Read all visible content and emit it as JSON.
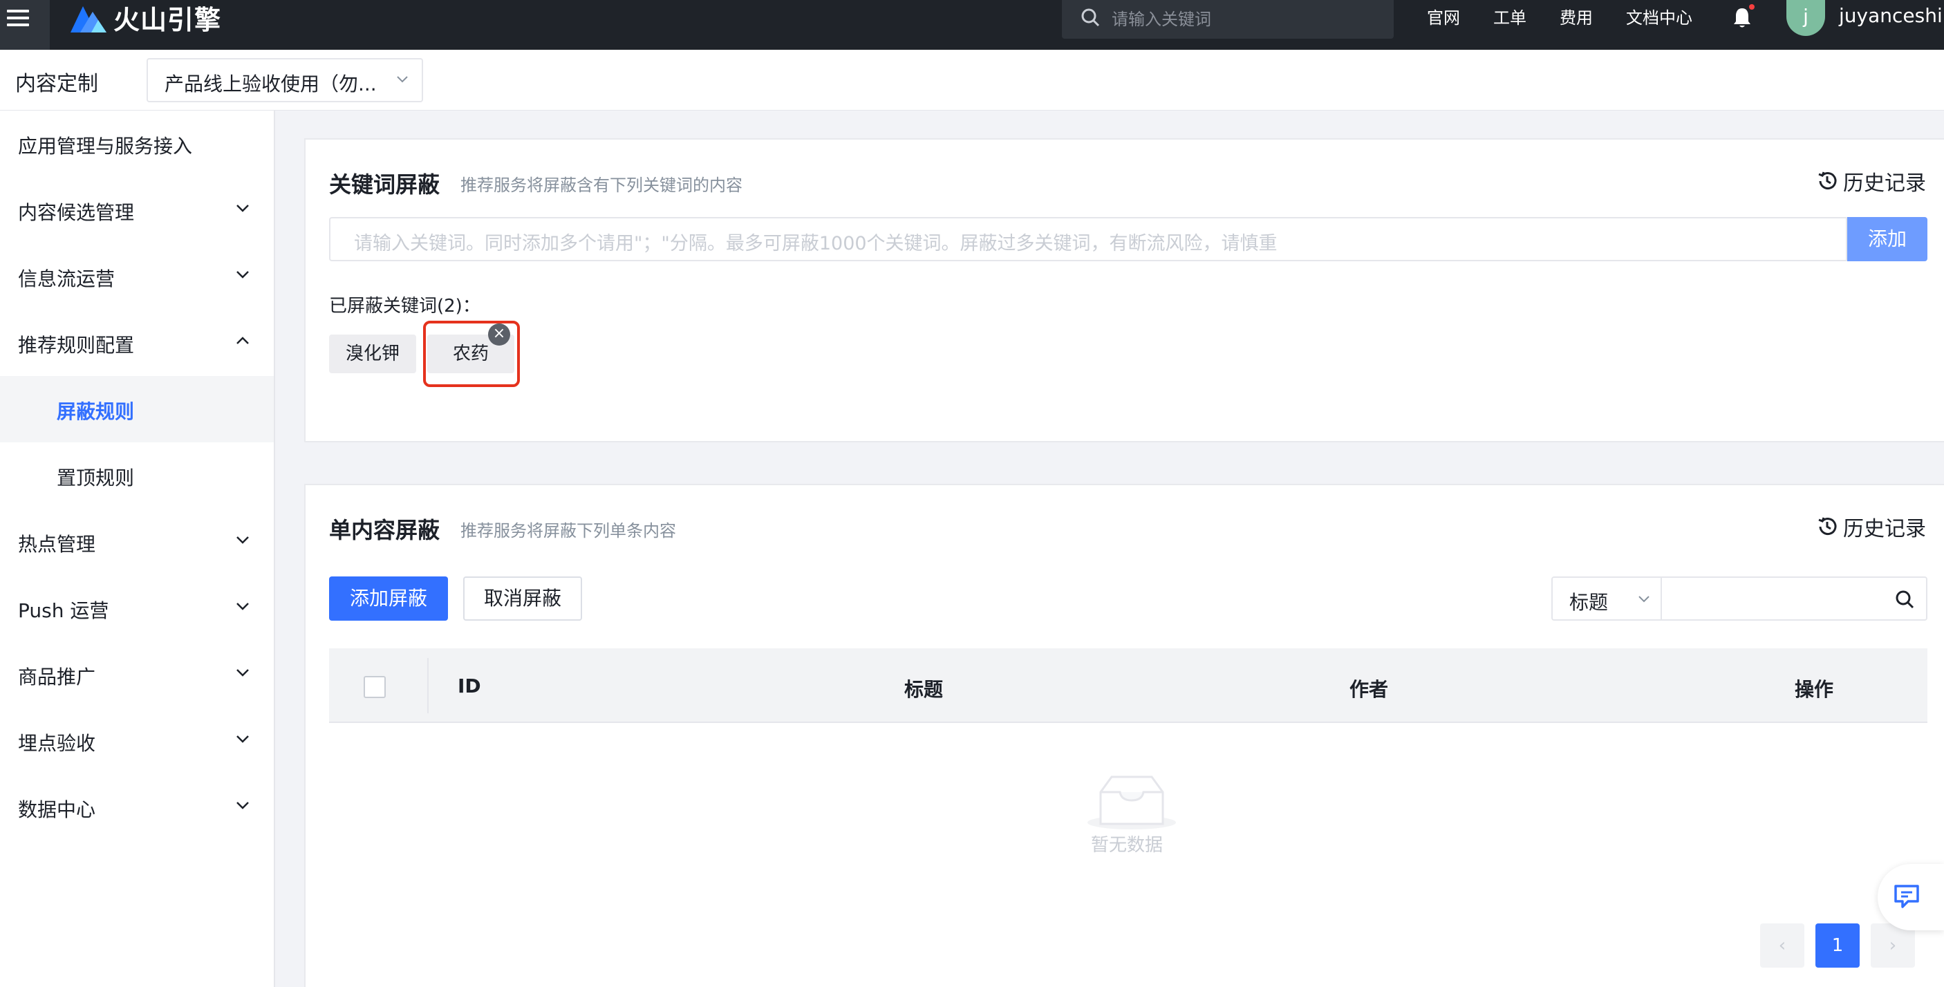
{
  "topbar": {
    "brand": "火山引擎",
    "search_placeholder": "请输入关键词",
    "links": [
      "官网",
      "工单",
      "费用",
      "文档中心"
    ],
    "avatar_initial": "j",
    "username": "juyanceshi"
  },
  "subheader": {
    "title": "内容定制",
    "project_select": "产品线上验收使用（勿..."
  },
  "sidebar": {
    "items": [
      {
        "label": "应用管理与服务接入"
      },
      {
        "label": "内容候选管理"
      },
      {
        "label": "信息流运营"
      },
      {
        "label": "推荐规则配置"
      },
      {
        "label": "屏蔽规则"
      },
      {
        "label": "置顶规则"
      },
      {
        "label": "热点管理"
      },
      {
        "label": "Push 运营"
      },
      {
        "label": "商品推广"
      },
      {
        "label": "埋点验收"
      },
      {
        "label": "数据中心"
      }
    ]
  },
  "keyword_block": {
    "title": "关键词屏蔽",
    "desc": "推荐服务将屏蔽含有下列关键词的内容",
    "history": "历史记录",
    "input_placeholder": "请输入关键词。同时添加多个请用\"；\"分隔。最多可屏蔽1000个关键词。屏蔽过多关键词，有断流风险，请慎重",
    "add_button": "添加",
    "blocked_label": "已屏蔽关键词(2)：",
    "tags": [
      "溴化钾",
      "农药"
    ],
    "close_glyph": "×"
  },
  "single_block": {
    "title": "单内容屏蔽",
    "desc": "推荐服务将屏蔽下列单条内容",
    "history": "历史记录",
    "add_button": "添加屏蔽",
    "cancel_button": "取消屏蔽",
    "filter_select": "标题",
    "columns": [
      "ID",
      "标题",
      "作者",
      "操作"
    ],
    "empty_text": "暂无数据"
  },
  "pagination": {
    "current": "1",
    "prev": "‹",
    "next": "›"
  },
  "colors": {
    "primary": "#3370ff",
    "highlight": "#e5321d",
    "topbar": "#1f2329"
  }
}
